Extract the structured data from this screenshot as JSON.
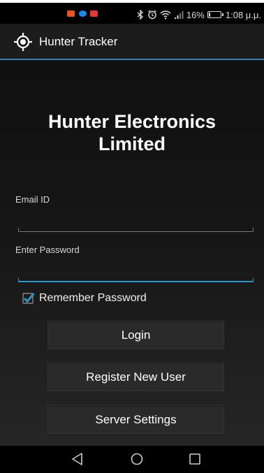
{
  "status_bar": {
    "notification_icons": [
      {
        "name": "app-notification-icon",
        "color": "#e6551f"
      },
      {
        "name": "messenger-icon",
        "color": "#1e88e5"
      },
      {
        "name": "youtube-icon",
        "color": "#e53935"
      }
    ],
    "battery_percent": "16%",
    "battery_level": 0.16,
    "time": "1:08 μ.μ."
  },
  "action_bar": {
    "title": "Hunter Tracker",
    "icon": "crosshair-icon",
    "accent_color": "#2b7fb0"
  },
  "main": {
    "company_line1": "Hunter Electronics",
    "company_line2": "Limited",
    "email": {
      "label": "Email ID",
      "value": ""
    },
    "password": {
      "label": "Enter Password",
      "value": ""
    },
    "remember": {
      "label": "Remember Password",
      "checked": true
    },
    "buttons": {
      "login": "Login",
      "register": "Register New User",
      "server_settings": "Server Settings"
    }
  },
  "nav_bar": {
    "icons": [
      "back-icon",
      "home-icon",
      "recents-icon"
    ]
  }
}
